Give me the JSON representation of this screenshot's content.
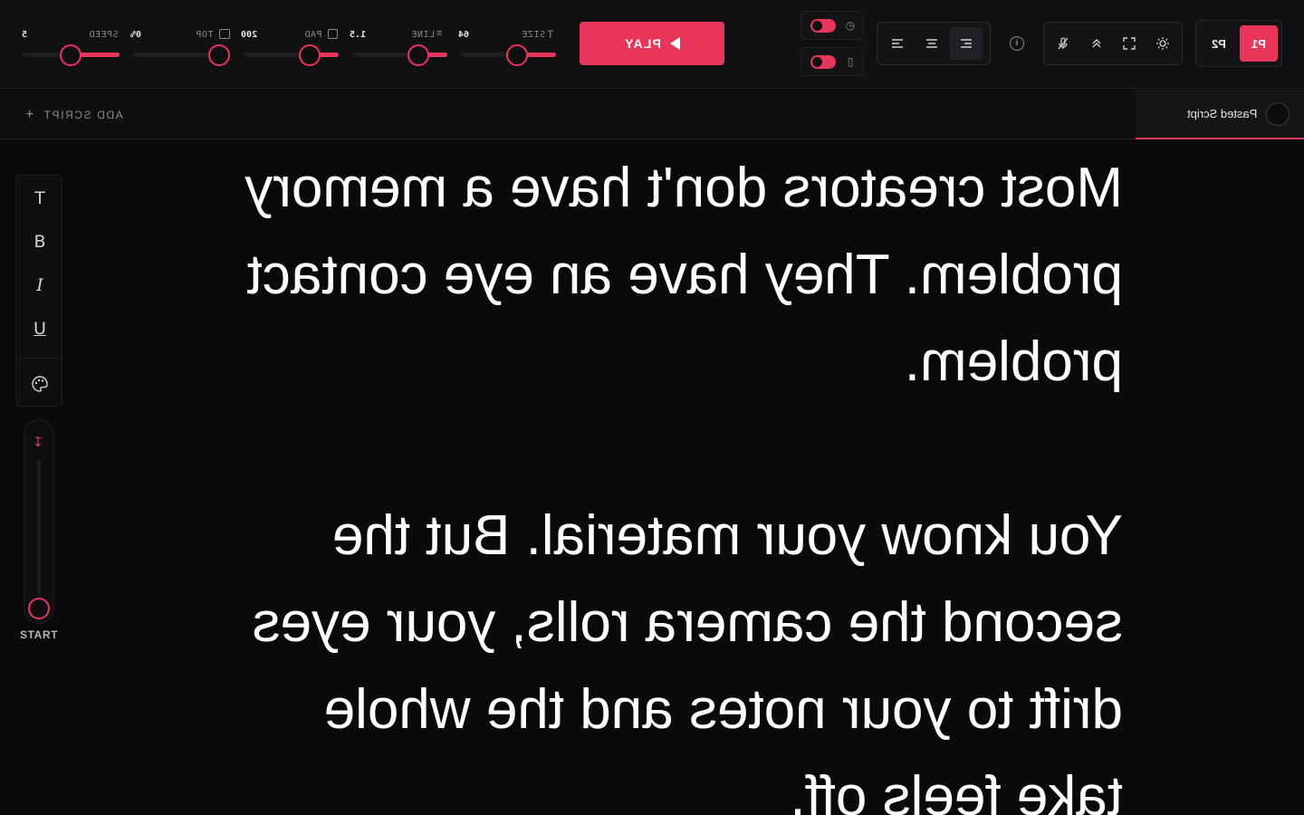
{
  "toolbar": {
    "sliders": [
      {
        "name": "SPEED",
        "value": "5",
        "pct_label": "0%"
      },
      {
        "name": "TOP",
        "value": "200"
      },
      {
        "name": "PAD",
        "value": "1.5"
      },
      {
        "name": "LINE",
        "value": "64"
      },
      {
        "name": "SIZE",
        "value": ""
      }
    ],
    "play_label": "PLAY",
    "profiles": {
      "p1": "P1",
      "p2": "P2"
    }
  },
  "tabs": {
    "add_script_label": "ADD SCRIPT",
    "active_tab_label": "Pasted Script"
  },
  "sidebar": {
    "start_label": "START"
  },
  "script": {
    "paragraphs": [
      "Most creators don't have a memory problem. They have an eye contact problem.",
      "You know your material. But the second the camera rolls, your eyes drift to your notes and the whole take feels off."
    ]
  },
  "colors": {
    "accent": "#e8355a",
    "background": "#0a0a0b",
    "toolbar": "#111113"
  }
}
